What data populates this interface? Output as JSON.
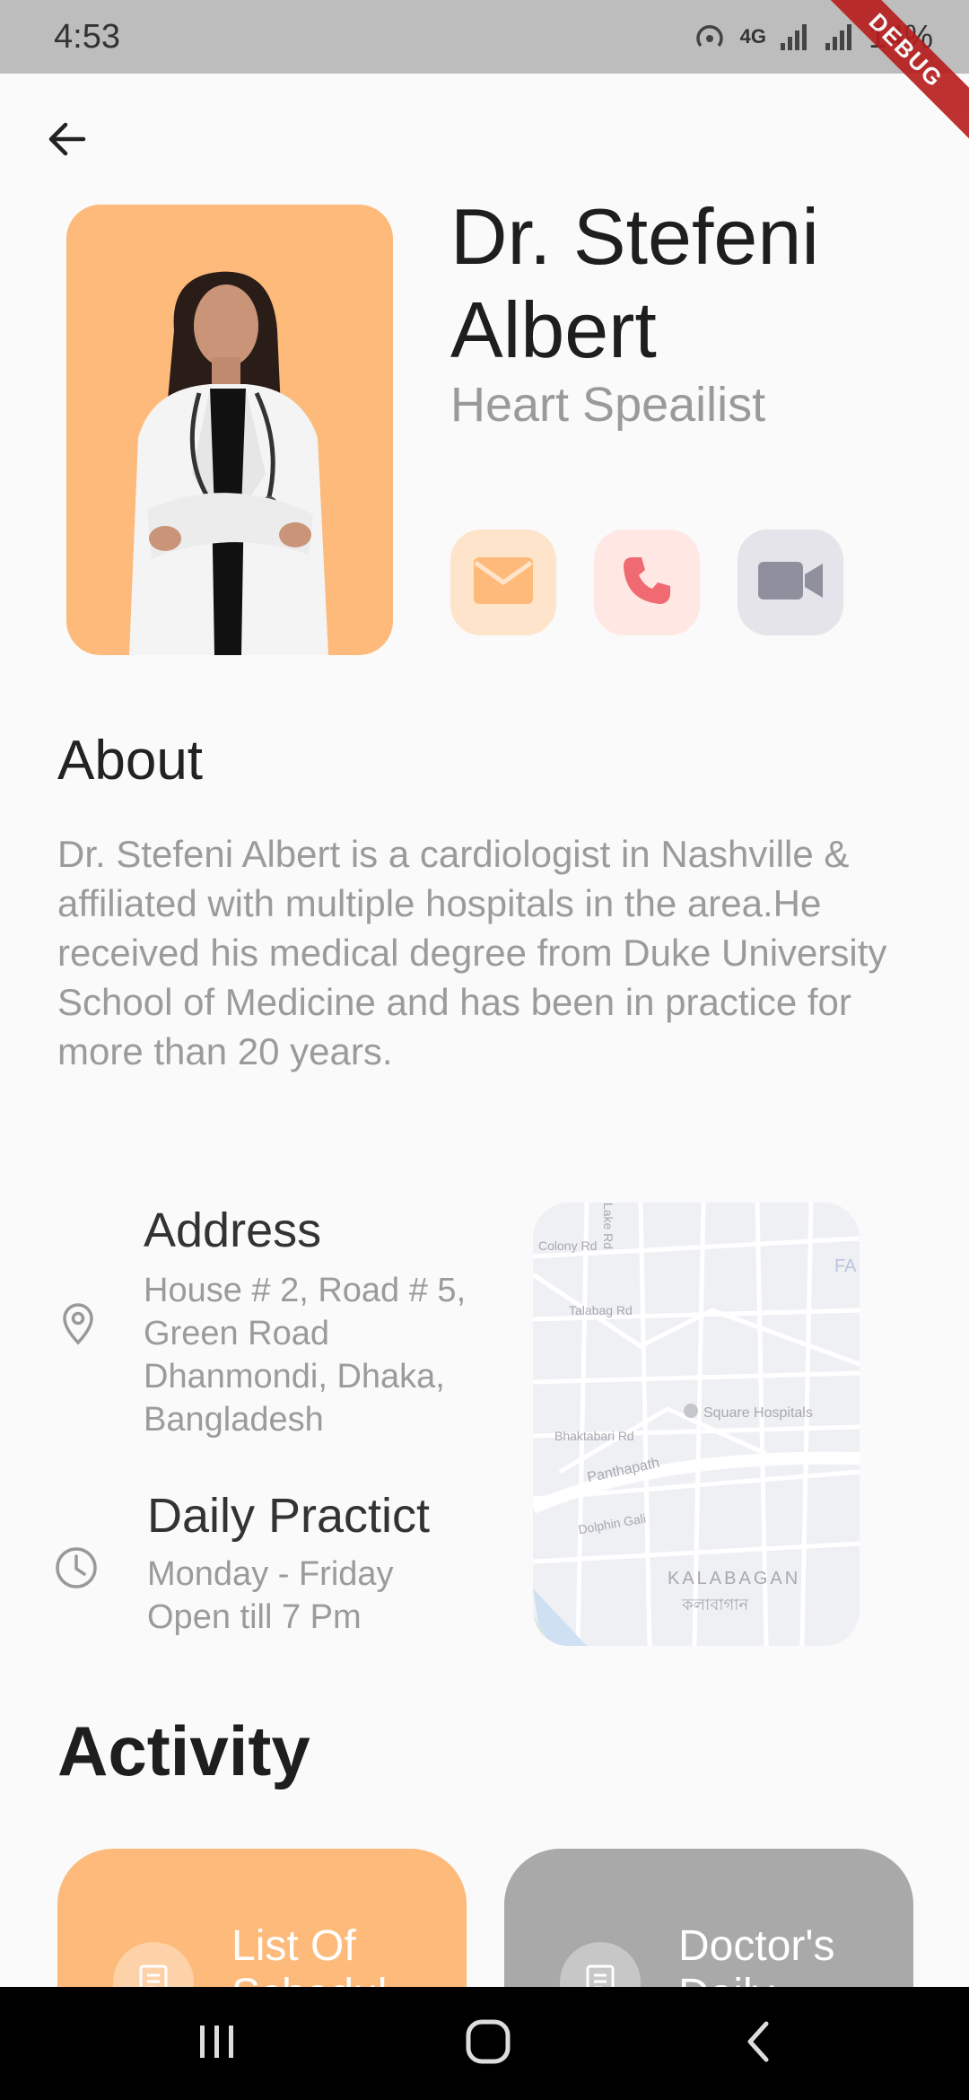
{
  "status_bar": {
    "time": "4:53",
    "network": "4G",
    "battery": "14%",
    "debug_label": "DEBUG"
  },
  "doctor": {
    "name": "Dr. Stefeni Albert",
    "specialty": "Heart Speailist"
  },
  "contact": {
    "mail_icon": "mail-icon",
    "call_icon": "phone-icon",
    "video_icon": "video-icon",
    "colors": {
      "mail": "#fdba7a",
      "call": "#f06a72",
      "video": "#8f8f9e"
    }
  },
  "about": {
    "title": "About",
    "text": "Dr. Stefeni Albert is a cardiologist in Nashville & affiliated with multiple hospitals in the area.He received his medical degree from Duke University School of Medicine and has been in practice for more than 20 years."
  },
  "address": {
    "title": "Address",
    "lines": [
      "House # 2, Road # 5,",
      "Green Road",
      "Dhanmondi, Dhaka,",
      "Bangladesh"
    ]
  },
  "practice": {
    "title": "Daily Practict",
    "lines": [
      "Monday - Friday",
      "Open till 7 Pm"
    ]
  },
  "map": {
    "labels": [
      "Colony Rd",
      "Lake Rd",
      "Talabag Rd",
      "Square Hospitals",
      "Bhaktabari Rd",
      "Panthapath",
      "Dolphin Gali",
      "KALABAGAN",
      "কলাবাগান",
      "FA"
    ]
  },
  "activity": {
    "title": "Activity",
    "cards": [
      {
        "label": "List Of Schedul",
        "color": "#fdba7a"
      },
      {
        "label": "Doctor's Daily",
        "color": "#a9a9a9"
      }
    ]
  },
  "nav": {
    "recents_icon": "recents-icon",
    "home_icon": "home-icon",
    "back_icon": "back-icon"
  }
}
